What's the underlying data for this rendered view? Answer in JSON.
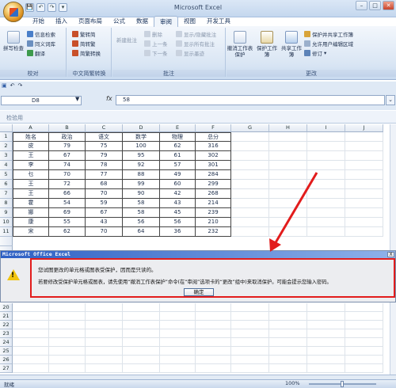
{
  "window": {
    "title": "Microsoft Excel"
  },
  "qat": [
    "💾",
    "↶",
    "↷",
    "▾"
  ],
  "tabs": [
    "开始",
    "插入",
    "页面布局",
    "公式",
    "数据",
    "审阅",
    "视图",
    "开发工具"
  ],
  "active_tab": "审阅",
  "ribbon": {
    "proofing": {
      "big": "拼写检查",
      "items": [
        "信息检索",
        "同义词库",
        "翻译"
      ],
      "label": "校对"
    },
    "chinese": {
      "items": [
        "繁转简",
        "简转繁",
        "简繁转换"
      ],
      "label": "中文简繁转换"
    },
    "comments": {
      "big": "新建批注",
      "items": [
        "删除",
        "上一条",
        "下一条",
        "显示/隐藏批注",
        "显示所有批注",
        "显示墨迹"
      ],
      "label": "批注"
    },
    "changes": {
      "big1": "撤消工作表保护",
      "big2": "保护工作簿",
      "big3": "共享工作簿",
      "items": [
        "保护并共享工作簿",
        "允许用户编辑区域",
        "修订"
      ],
      "label": "更改"
    }
  },
  "formula_bar": {
    "name_box": "D8",
    "fx": "fx",
    "value": "58"
  },
  "vba_bar": {
    "label": "检验用"
  },
  "columns": [
    "A",
    "B",
    "C",
    "D",
    "E",
    "F",
    "G",
    "H",
    "I",
    "J"
  ],
  "table": {
    "header": [
      "姓名",
      "政治",
      "语文",
      "数学",
      "物理",
      "总分"
    ],
    "rows": [
      [
        "皮",
        "79",
        "75",
        "100",
        "62",
        "316"
      ],
      [
        "王",
        "67",
        "79",
        "95",
        "61",
        "302"
      ],
      [
        "李",
        "74",
        "78",
        "92",
        "57",
        "301"
      ],
      [
        "乜",
        "70",
        "77",
        "88",
        "49",
        "284"
      ],
      [
        "王",
        "72",
        "68",
        "99",
        "60",
        "299"
      ],
      [
        "王",
        "66",
        "70",
        "90",
        "42",
        "268"
      ],
      [
        "霍",
        "54",
        "59",
        "58",
        "43",
        "214"
      ],
      [
        "娜",
        "69",
        "67",
        "58",
        "45",
        "239"
      ],
      [
        "康",
        "55",
        "43",
        "56",
        "56",
        "210"
      ],
      [
        "宋",
        "62",
        "70",
        "64",
        "36",
        "232"
      ]
    ]
  },
  "lower_rows": [
    "20",
    "21",
    "22",
    "23",
    "24",
    "25",
    "26",
    "27"
  ],
  "dialog": {
    "title": "Microsoft Office Excel",
    "close": "X",
    "line1": "您试图更改的单元格或图表受保护，因而是只读的。",
    "line2": "若要修改受保护单元格或图表，请先使用“撤消工作表保护”命令(在“审阅”选项卡的“更改”组中)来取消保护。可能会提示您输入密码。",
    "ok": "确定"
  },
  "status": {
    "ready": "就绪",
    "zoom": "100%"
  },
  "colors": {
    "accent": "#2d60c4",
    "highlight": "#e21c1c",
    "warning": "#f1c40f"
  }
}
